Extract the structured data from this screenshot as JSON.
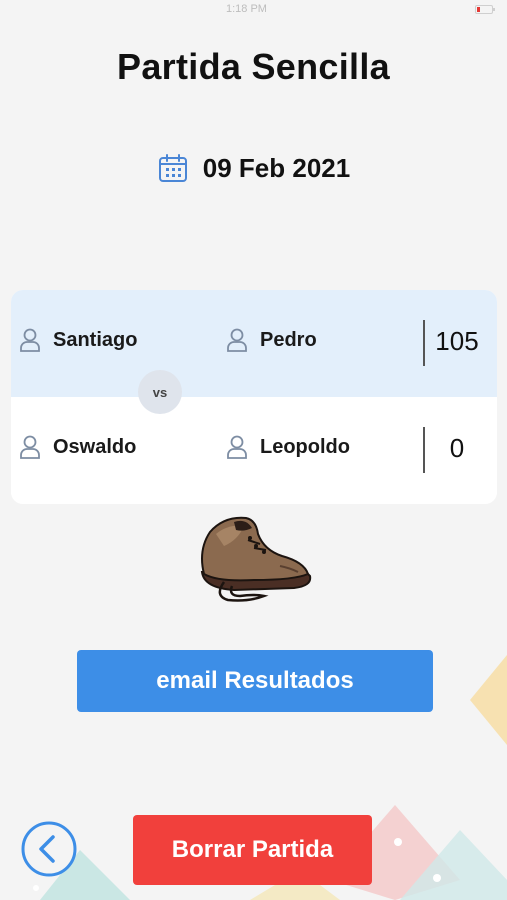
{
  "status_bar": {
    "carrier": "",
    "time": "1:18 PM"
  },
  "title": "Partida Sencilla",
  "date": {
    "icon": "calendar-icon",
    "text": "09 Feb 2021"
  },
  "match": {
    "vs_label": "vs",
    "teams": [
      {
        "players": [
          {
            "name": "Santiago",
            "icon": "user-icon"
          },
          {
            "name": "Pedro",
            "icon": "user-icon"
          }
        ],
        "score": "105"
      },
      {
        "players": [
          {
            "name": "Oswaldo",
            "icon": "user-icon"
          },
          {
            "name": "Leopoldo",
            "icon": "user-icon"
          }
        ],
        "score": "0"
      }
    ]
  },
  "shoe_image": {
    "icon": "shoe-icon"
  },
  "buttons": {
    "email_label": "email Resultados",
    "delete_label": "Borrar Partida",
    "back_icon": "chevron-left-icon"
  },
  "colors": {
    "primary_blue": "#3d8ee7",
    "danger_red": "#f1403c",
    "winner_row_bg": "#e3effb",
    "background": "#f4f4f4"
  }
}
